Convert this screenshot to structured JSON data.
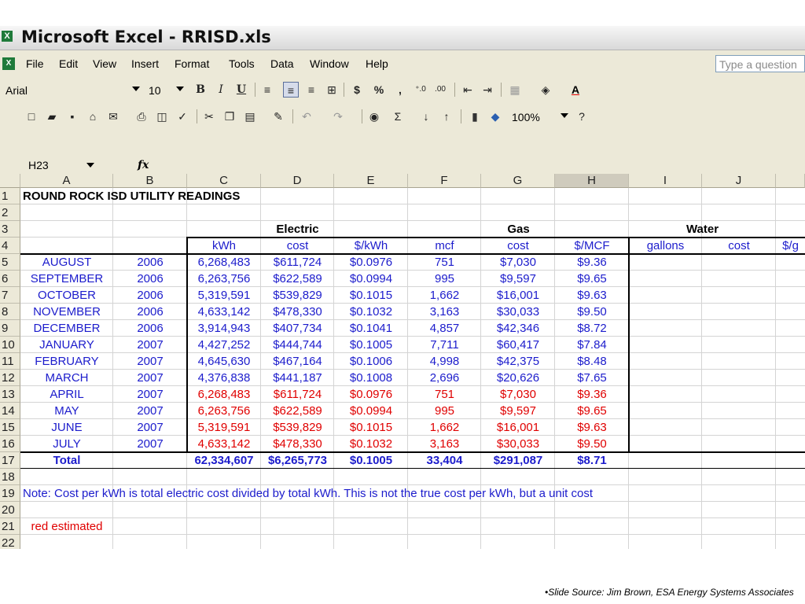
{
  "window": {
    "title": "Microsoft Excel - RRISD.xls"
  },
  "menu": {
    "items": [
      {
        "label": "File"
      },
      {
        "label": "Edit"
      },
      {
        "label": "View"
      },
      {
        "label": "Insert"
      },
      {
        "label": "Format"
      },
      {
        "label": "Tools"
      },
      {
        "label": "Data"
      },
      {
        "label": "Window"
      },
      {
        "label": "Help"
      }
    ]
  },
  "ask_placeholder": "Type a question",
  "format_toolbar": {
    "font": "Arial",
    "size": "10",
    "bold": "B",
    "italic": "I",
    "underline": "U",
    "currency": "$",
    "percent": "%",
    "comma": ","
  },
  "standard_toolbar": {
    "zoom": "100%",
    "sigma": "Σ"
  },
  "formula_bar": {
    "name_box": "H23",
    "fx": "fx"
  },
  "columns": [
    "A",
    "B",
    "C",
    "D",
    "E",
    "F",
    "G",
    "H",
    "I",
    "J"
  ],
  "rows": [
    "1",
    "2",
    "3",
    "4",
    "5",
    "6",
    "7",
    "8",
    "9",
    "10",
    "11",
    "12",
    "13",
    "14",
    "15",
    "16",
    "17",
    "18",
    "19",
    "20",
    "21",
    "22"
  ],
  "sheet": {
    "title": "ROUND ROCK ISD UTILITY READINGS",
    "group_headers": {
      "electric": "Electric",
      "gas": "Gas",
      "water": "Water"
    },
    "sub_headers": [
      "kWh",
      "cost",
      "$/kWh",
      "mcf",
      "cost",
      "$/MCF",
      "gallons",
      "cost",
      "$/g"
    ],
    "data_rows": [
      {
        "month": "AUGUST",
        "year": "2006",
        "kwh": "6,268,483",
        "ecost": "$611,724",
        "perkwh": "$0.0976",
        "mcf": "751",
        "gcost": "$7,030",
        "permcf": "$9.36",
        "estimated": false
      },
      {
        "month": "SEPTEMBER",
        "year": "2006",
        "kwh": "6,263,756",
        "ecost": "$622,589",
        "perkwh": "$0.0994",
        "mcf": "995",
        "gcost": "$9,597",
        "permcf": "$9.65",
        "estimated": false
      },
      {
        "month": "OCTOBER",
        "year": "2006",
        "kwh": "5,319,591",
        "ecost": "$539,829",
        "perkwh": "$0.1015",
        "mcf": "1,662",
        "gcost": "$16,001",
        "permcf": "$9.63",
        "estimated": false
      },
      {
        "month": "NOVEMBER",
        "year": "2006",
        "kwh": "4,633,142",
        "ecost": "$478,330",
        "perkwh": "$0.1032",
        "mcf": "3,163",
        "gcost": "$30,033",
        "permcf": "$9.50",
        "estimated": false
      },
      {
        "month": "DECEMBER",
        "year": "2006",
        "kwh": "3,914,943",
        "ecost": "$407,734",
        "perkwh": "$0.1041",
        "mcf": "4,857",
        "gcost": "$42,346",
        "permcf": "$8.72",
        "estimated": false
      },
      {
        "month": "JANUARY",
        "year": "2007",
        "kwh": "4,427,252",
        "ecost": "$444,744",
        "perkwh": "$0.1005",
        "mcf": "7,711",
        "gcost": "$60,417",
        "permcf": "$7.84",
        "estimated": false
      },
      {
        "month": "FEBRUARY",
        "year": "2007",
        "kwh": "4,645,630",
        "ecost": "$467,164",
        "perkwh": "$0.1006",
        "mcf": "4,998",
        "gcost": "$42,375",
        "permcf": "$8.48",
        "estimated": false
      },
      {
        "month": "MARCH",
        "year": "2007",
        "kwh": "4,376,838",
        "ecost": "$441,187",
        "perkwh": "$0.1008",
        "mcf": "2,696",
        "gcost": "$20,626",
        "permcf": "$7.65",
        "estimated": false
      },
      {
        "month": "APRIL",
        "year": "2007",
        "kwh": "6,268,483",
        "ecost": "$611,724",
        "perkwh": "$0.0976",
        "mcf": "751",
        "gcost": "$7,030",
        "permcf": "$9.36",
        "estimated": true
      },
      {
        "month": "MAY",
        "year": "2007",
        "kwh": "6,263,756",
        "ecost": "$622,589",
        "perkwh": "$0.0994",
        "mcf": "995",
        "gcost": "$9,597",
        "permcf": "$9.65",
        "estimated": true
      },
      {
        "month": "JUNE",
        "year": "2007",
        "kwh": "5,319,591",
        "ecost": "$539,829",
        "perkwh": "$0.1015",
        "mcf": "1,662",
        "gcost": "$16,001",
        "permcf": "$9.63",
        "estimated": true
      },
      {
        "month": "JULY",
        "year": "2007",
        "kwh": "4,633,142",
        "ecost": "$478,330",
        "perkwh": "$0.1032",
        "mcf": "3,163",
        "gcost": "$30,033",
        "permcf": "$9.50",
        "estimated": true
      }
    ],
    "total": {
      "label": "Total",
      "kwh": "62,334,607",
      "ecost": "$6,265,773",
      "perkwh": "$0.1005",
      "mcf": "33,404",
      "gcost": "$291,087",
      "permcf": "$8.71"
    },
    "note": "Note: Cost per kWh is total electric cost divided by total kWh.  This is not the true cost per kWh, but a unit cost",
    "legend": "red estimated"
  },
  "colors": {
    "blue_text": "#1c1ccc",
    "red_text": "#e00000",
    "chrome": "#ece9d8"
  },
  "slide_source": "•Slide Source: Jim Brown,  ESA Energy Systems Associates"
}
